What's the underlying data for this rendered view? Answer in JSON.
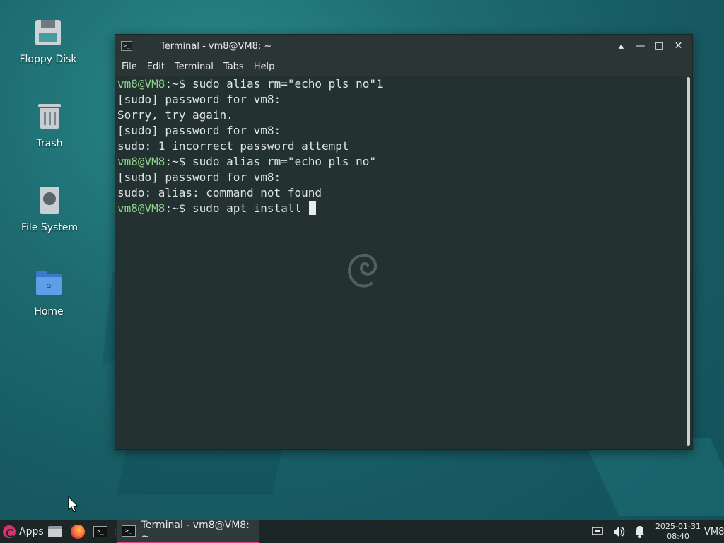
{
  "desktop": {
    "icons": [
      {
        "label": "Floppy Disk",
        "icon": "floppy-disk-icon"
      },
      {
        "label": "Trash",
        "icon": "trash-icon"
      },
      {
        "label": "File System",
        "icon": "hard-drive-icon"
      },
      {
        "label": "Home",
        "icon": "home-folder-icon"
      }
    ]
  },
  "terminal": {
    "title": "Terminal - vm8@VM8: ~",
    "window_controls": {
      "shade": "▴",
      "minimize": "—",
      "maximize": "□",
      "close": "✕"
    },
    "menu": [
      "File",
      "Edit",
      "Terminal",
      "Tabs",
      "Help"
    ],
    "lines": [
      {
        "prompt": "vm8@VM8",
        "path": ":~$ ",
        "text": "sudo alias rm=\"echo pls no\"1"
      },
      {
        "prompt": "",
        "path": "",
        "text": "[sudo] password for vm8:"
      },
      {
        "prompt": "",
        "path": "",
        "text": "Sorry, try again."
      },
      {
        "prompt": "",
        "path": "",
        "text": "[sudo] password for vm8:"
      },
      {
        "prompt": "",
        "path": "",
        "text": "sudo: 1 incorrect password attempt"
      },
      {
        "prompt": "vm8@VM8",
        "path": ":~$ ",
        "text": "sudo alias rm=\"echo pls no\""
      },
      {
        "prompt": "",
        "path": "",
        "text": "[sudo] password for vm8:"
      },
      {
        "prompt": "",
        "path": "",
        "text": "sudo: alias: command not found"
      },
      {
        "prompt": "vm8@VM8",
        "path": ":~$ ",
        "text": "sudo apt install "
      }
    ]
  },
  "taskbar": {
    "apps_label": "Apps",
    "task_title": "Terminal - vm8@VM8: ~",
    "clock_date": "2025-01-31",
    "clock_time": "08:40",
    "hostname": "VM8",
    "colors": {
      "accent": "#e0457e",
      "prompt": "#8fd18f"
    }
  }
}
